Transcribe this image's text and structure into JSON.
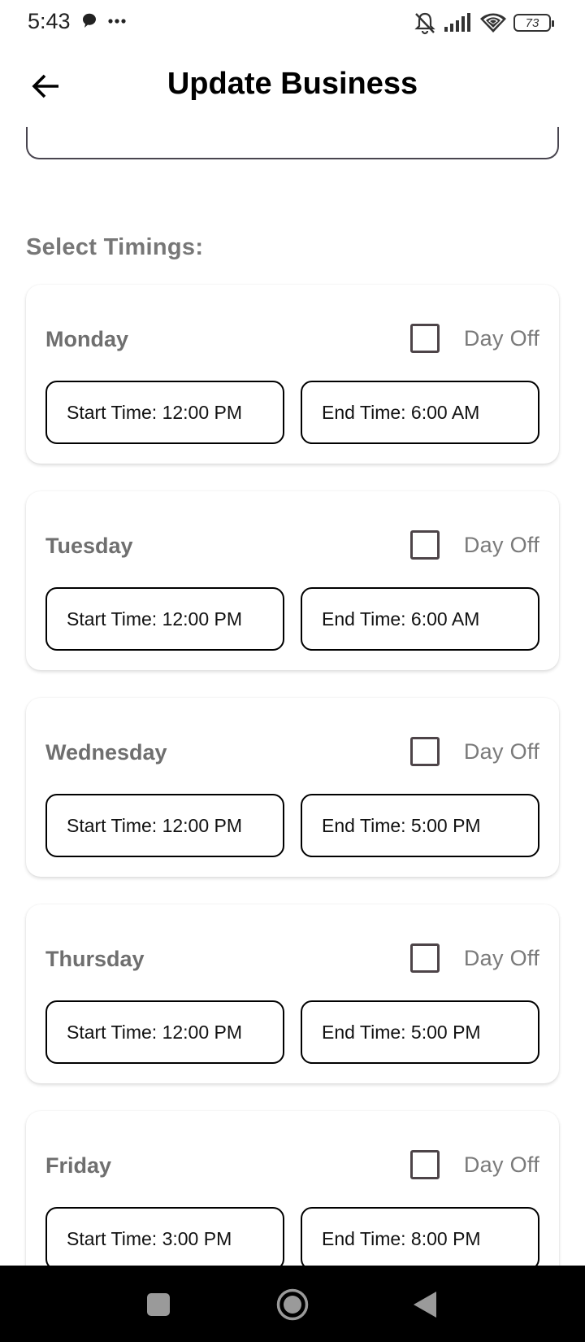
{
  "status_bar": {
    "time": "5:43",
    "battery": "73",
    "icons": [
      "chat-bubble-icon",
      "more-dots-icon",
      "bell-off-icon",
      "signal-icon",
      "wifi-icon",
      "battery-icon"
    ]
  },
  "app_bar": {
    "title": "Update Business",
    "back_icon": "arrow-left-icon"
  },
  "timings": {
    "section_label": "Select Timings:",
    "days": [
      {
        "name": "Monday",
        "day_off_label": "Day Off",
        "day_off": false,
        "start": "Start Time: 12:00 PM",
        "end": "End Time: 6:00 AM"
      },
      {
        "name": "Tuesday",
        "day_off_label": "Day Off",
        "day_off": false,
        "start": "Start Time: 12:00 PM",
        "end": "End Time: 6:00 AM"
      },
      {
        "name": "Wednesday",
        "day_off_label": "Day Off",
        "day_off": false,
        "start": "Start Time: 12:00 PM",
        "end": "End Time: 5:00 PM"
      },
      {
        "name": "Thursday",
        "day_off_label": "Day Off",
        "day_off": false,
        "start": "Start Time: 12:00 PM",
        "end": "End Time: 5:00 PM"
      },
      {
        "name": "Friday",
        "day_off_label": "Day Off",
        "day_off": false,
        "start": "Start Time: 3:00 PM",
        "end": "End Time: 8:00 PM"
      }
    ]
  },
  "nav_bar": {
    "icons": [
      "recents-square-icon",
      "home-circle-icon",
      "back-triangle-icon"
    ]
  },
  "colors": {
    "label_gray": "#6f6f6f",
    "checkbox_border": "#4d4448",
    "nav_bg": "#000000"
  }
}
